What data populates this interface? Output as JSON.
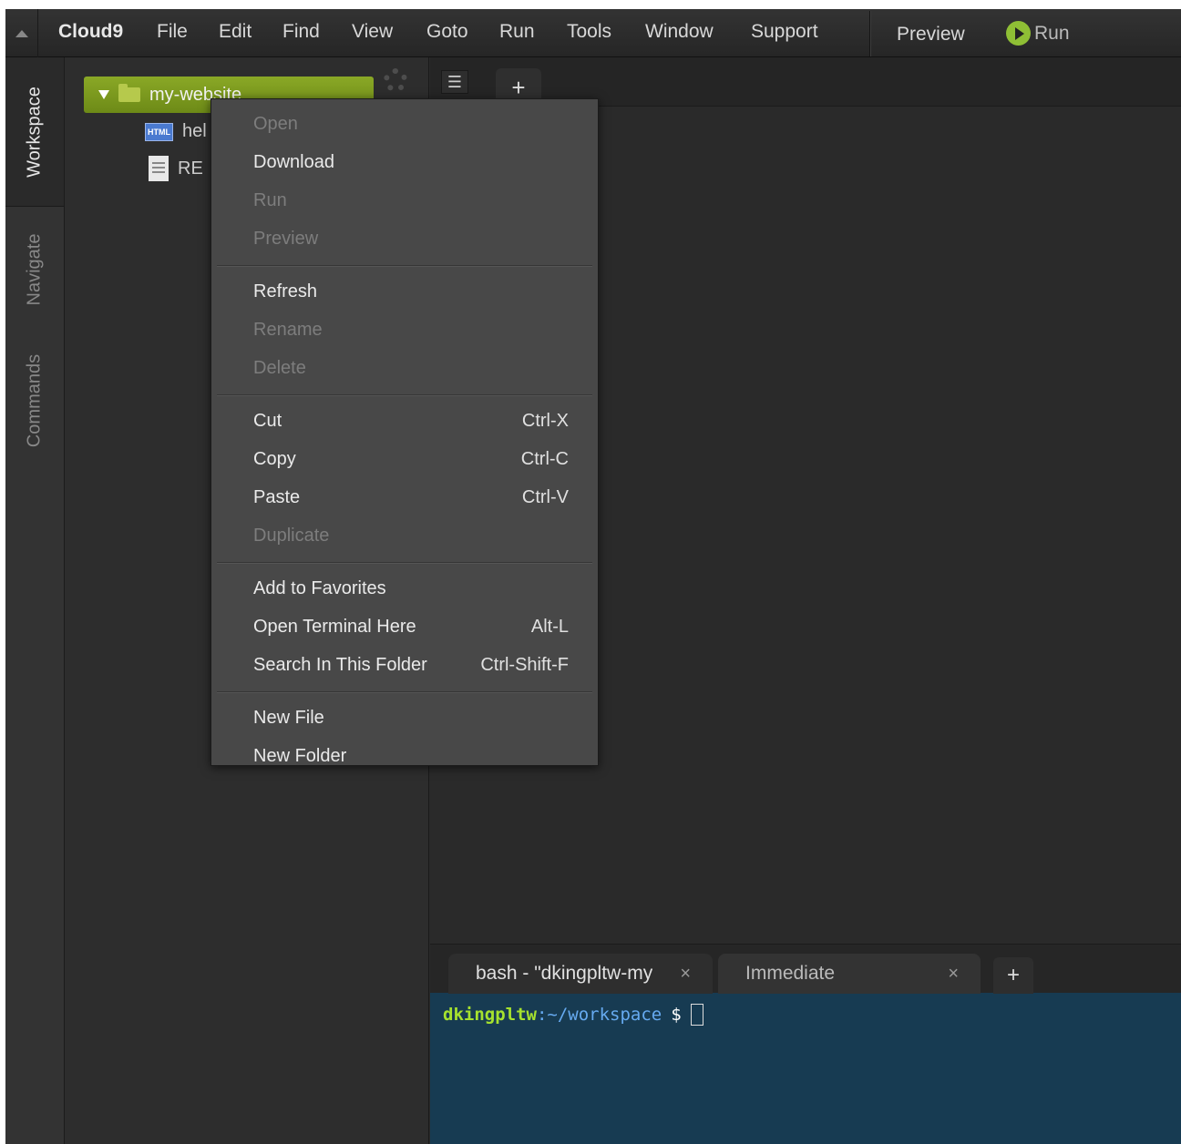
{
  "menubar": {
    "brand": "Cloud9",
    "items": [
      "File",
      "Edit",
      "Find",
      "View",
      "Goto",
      "Run",
      "Tools",
      "Window",
      "Support"
    ],
    "preview": "Preview",
    "run": "Run"
  },
  "sidetabs": [
    "Workspace",
    "Navigate",
    "Commands"
  ],
  "tree": {
    "root": "my-website",
    "files": [
      {
        "label": "hel",
        "icon": "HTML"
      },
      {
        "label": "RE",
        "icon": "doc"
      }
    ]
  },
  "editor": {
    "plus": "+",
    "tab_menu_icon": "list-icon"
  },
  "console": {
    "tabs": [
      {
        "label": "bash - \"dkingpltw-mу",
        "close": "×"
      },
      {
        "label": "Immediate",
        "close": "×"
      }
    ],
    "plus": "+",
    "prompt_user": "dkingpltw",
    "prompt_path": ":~/workspace",
    "prompt_symbol": "$"
  },
  "context_menu": {
    "groups": [
      [
        {
          "label": "Open",
          "disabled": true,
          "shortcut": ""
        },
        {
          "label": "Download",
          "disabled": false,
          "shortcut": ""
        },
        {
          "label": "Run",
          "disabled": true,
          "shortcut": ""
        },
        {
          "label": "Preview",
          "disabled": true,
          "shortcut": ""
        }
      ],
      [
        {
          "label": "Refresh",
          "disabled": false,
          "shortcut": ""
        },
        {
          "label": "Rename",
          "disabled": true,
          "shortcut": ""
        },
        {
          "label": "Delete",
          "disabled": true,
          "shortcut": ""
        }
      ],
      [
        {
          "label": "Cut",
          "disabled": false,
          "shortcut": "Ctrl-X"
        },
        {
          "label": "Copy",
          "disabled": false,
          "shortcut": "Ctrl-C"
        },
        {
          "label": "Paste",
          "disabled": false,
          "shortcut": "Ctrl-V"
        },
        {
          "label": "Duplicate",
          "disabled": true,
          "shortcut": ""
        }
      ],
      [
        {
          "label": "Add to Favorites",
          "disabled": false,
          "shortcut": ""
        },
        {
          "label": "Open Terminal Here",
          "disabled": false,
          "shortcut": "Alt-L"
        },
        {
          "label": "Search In This Folder",
          "disabled": false,
          "shortcut": "Ctrl-Shift-F"
        }
      ],
      [
        {
          "label": "New File",
          "disabled": false,
          "shortcut": ""
        },
        {
          "label": "New Folder",
          "disabled": false,
          "shortcut": ""
        }
      ]
    ]
  },
  "colors": {
    "accent_green": "#8aa826",
    "terminal_bg": "#173b52",
    "prompt_user": "#a6e22e",
    "prompt_path": "#66aaf0"
  }
}
